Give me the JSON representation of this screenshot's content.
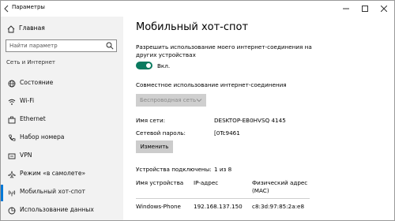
{
  "window": {
    "title": "Параметры"
  },
  "sidebar": {
    "home_label": "Главная",
    "search_placeholder": "Найти параметр",
    "section_title": "Сеть и Интернет",
    "items": [
      {
        "label": "Состояние",
        "icon": "globe-icon"
      },
      {
        "label": "Wi-Fi",
        "icon": "wifi-icon"
      },
      {
        "label": "Ethernet",
        "icon": "ethernet-icon"
      },
      {
        "label": "Набор номера",
        "icon": "phone-icon"
      },
      {
        "label": "VPN",
        "icon": "vpn-icon"
      },
      {
        "label": "Режим «в самолете»",
        "icon": "airplane-icon"
      },
      {
        "label": "Мобильный хот-спот",
        "icon": "hotspot-icon",
        "active": true
      },
      {
        "label": "Использование данных",
        "icon": "data-usage-icon"
      }
    ]
  },
  "main": {
    "title": "Мобильный хот-спот",
    "share_description": "Разрешить использование моего интернет-соединения на других устройствах",
    "share_desc_line1": "Разрешить использование моего интернет-соединения на",
    "share_desc_line2": "других устройствах",
    "toggle_state": "Вкл.",
    "toggle_on": true,
    "share_from_label": "Совместное использование интернет-соединения",
    "share_from_value": "Беспроводная сеть",
    "network_name_label": "Имя сети:",
    "network_name_value": "DESKTOP-EB0HVSQ 4145",
    "password_label": "Сетевой пароль:",
    "password_value": "[0Tc9461",
    "edit_button": "Изменить",
    "connected_label": "Устройства подключены:",
    "connected_value": "1 из 8",
    "table": {
      "headers": [
        "Имя устройства",
        "IP-адрес",
        "Физический адрес (MAC)"
      ],
      "header_mac_line1": "Физический адрес",
      "header_mac_line2": "(MAC)",
      "rows": [
        {
          "name": "Windows-Phone",
          "ip": "192.168.137.150",
          "mac": "c8:3d:97:85:2a:e8"
        }
      ]
    }
  },
  "colors": {
    "accent": "#0078d7",
    "toggle_on": "#0a7a5f",
    "sidebar_bg": "#f2f2f2"
  }
}
